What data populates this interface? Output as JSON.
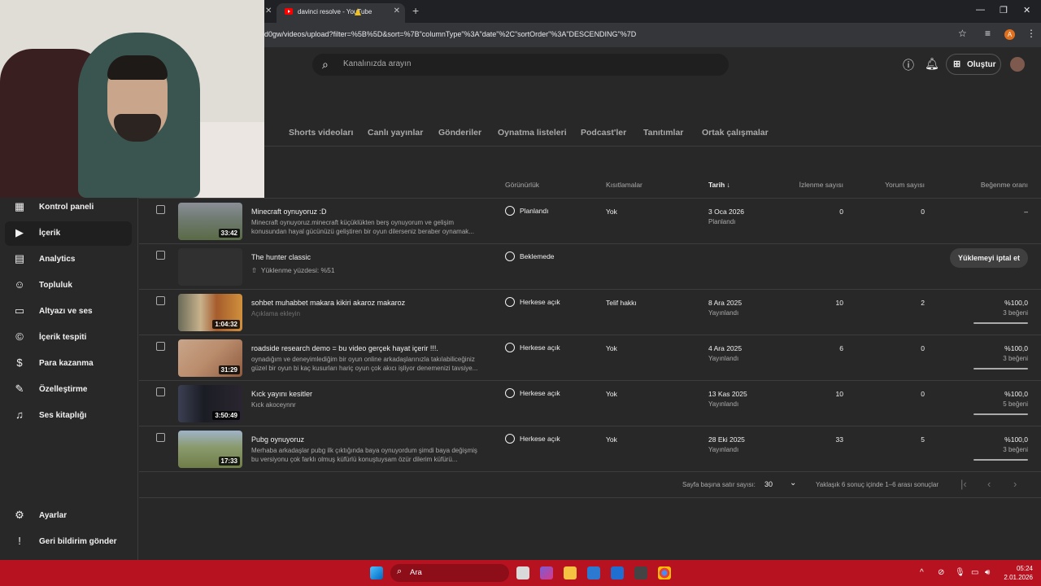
{
  "browser": {
    "tab_title": "davinci resolve - YouTube",
    "tab_close": "✕",
    "prev_tab_close": "✕",
    "new_tab": "+",
    "url": "d0gw/videos/upload?filter=%5B%5D&sort=%7B\"columnType\"%3A\"date\"%2C\"sortOrder\"%3A\"DESCENDING\"%7D",
    "profile_letter": "A",
    "window": {
      "minimize": "—",
      "restore": "❐",
      "close": "✕"
    }
  },
  "header": {
    "search_placeholder": "Kanalınızda arayın",
    "create_label": "Oluştur"
  },
  "content_tabs": [
    "r",
    "Shorts videoları",
    "Canlı yayınlar",
    "Gönderiler",
    "Oynatma listeleri",
    "Podcast'ler",
    "Tanıtımlar",
    "Ortak çalışmalar"
  ],
  "sidebar": {
    "items": [
      {
        "label": "Kontrol paneli",
        "icon": "dashboard-icon"
      },
      {
        "label": "İçerik",
        "icon": "content-icon"
      },
      {
        "label": "Analytics",
        "icon": "analytics-icon"
      },
      {
        "label": "Topluluk",
        "icon": "community-icon"
      },
      {
        "label": "Altyazı ve ses",
        "icon": "subtitles-icon"
      },
      {
        "label": "İçerik tespiti",
        "icon": "copyright-icon"
      },
      {
        "label": "Para kazanma",
        "icon": "monetization-icon"
      },
      {
        "label": "Özelleştirme",
        "icon": "customization-icon"
      },
      {
        "label": "Ses kitaplığı",
        "icon": "audio-library-icon"
      }
    ],
    "bottom": [
      {
        "label": "Ayarlar",
        "icon": "settings-icon"
      },
      {
        "label": "Geri bildirim gönder",
        "icon": "feedback-icon"
      }
    ]
  },
  "table": {
    "headers": {
      "visibility": "Görünürlük",
      "restrictions": "Kısıtlamalar",
      "date": "Tarih",
      "views": "İzlenme sayısı",
      "comments": "Yorum sayısı",
      "likes": "Beğenme oranı"
    },
    "rows": [
      {
        "title": "Minecraft oynuyoruz :D",
        "desc": "Minecraft oynuyoruz.minecraft küçüklükten berş oynuyorum ve gelişim konusundan hayal gücünüzü geliştiren bir oyun dilerseniz beraber oynamak...",
        "duration": "33:42",
        "visibility": "Planlandı",
        "restrictions": "Yok",
        "date": "3 Oca 2026",
        "date_sub": "Planlandı",
        "views": "0",
        "comments": "0",
        "ratio": "–",
        "likes_count": ""
      },
      {
        "title": "The hunter classic",
        "upload_progress": "Yüklenme yüzdesi: %51",
        "visibility": "Beklemede",
        "cancel_label": "Yüklemeyi iptal et"
      },
      {
        "title": "sohbet muhabbet makara kikiri akaroz makaroz",
        "desc": "Açıklama ekleyin",
        "duration": "1:04:32",
        "visibility": "Herkese açık",
        "restrictions": "Telif hakkı",
        "date": "8 Ara 2025",
        "date_sub": "Yayınlandı",
        "views": "10",
        "comments": "2",
        "ratio": "%100,0",
        "likes_count": "3 beğeni"
      },
      {
        "title": "roadside research demo = bu video gerçek hayat içerir !!!.",
        "desc": "oynadığım ve deneyimlediğim bir oyun online arkadaşlarınızla takılabiliceğiniz güzel bir oyun bi kaç kusurları hariç oyun çok akıcı işliyor denemenizi tavsiye...",
        "duration": "31:29",
        "visibility": "Herkese açık",
        "restrictions": "Yok",
        "date": "4 Ara 2025",
        "date_sub": "Yayınlandı",
        "views": "6",
        "comments": "0",
        "ratio": "%100,0",
        "likes_count": "3 beğeni"
      },
      {
        "title": "Kıck yayını kesitler",
        "desc": "Kıck akoceynnr",
        "duration": "3:50:49",
        "visibility": "Herkese açık",
        "restrictions": "Yok",
        "date": "13 Kas 2025",
        "date_sub": "Yayınlandı",
        "views": "10",
        "comments": "0",
        "ratio": "%100,0",
        "likes_count": "5 beğeni"
      },
      {
        "title": "Pubg oynuyoruz",
        "desc": "Merhaba arkadaşlar pubg ilk çıktığında baya oynuyordum şimdi baya değişmiş bu versiyonu çok farklı olmuş küfürlü konuştuysam özür dilerim küfürü...",
        "duration": "17:33",
        "visibility": "Herkese açık",
        "restrictions": "Yok",
        "date": "28 Eki 2025",
        "date_sub": "Yayınlandı",
        "views": "33",
        "comments": "5",
        "ratio": "%100,0",
        "likes_count": "3 beğeni"
      }
    ]
  },
  "pagination": {
    "rows_label": "Sayfa başına satır sayısı:",
    "rows_value": "30",
    "range": "Yaklaşık 6 sonuç içinde 1–6 arası sonuçlar"
  },
  "taskbar": {
    "search_label": "Ara",
    "time": "05:24",
    "date": "2.01.2026"
  },
  "colors": {
    "taskbar": "#b7121f",
    "background": "#282828",
    "youtube_red": "#ff0000"
  }
}
